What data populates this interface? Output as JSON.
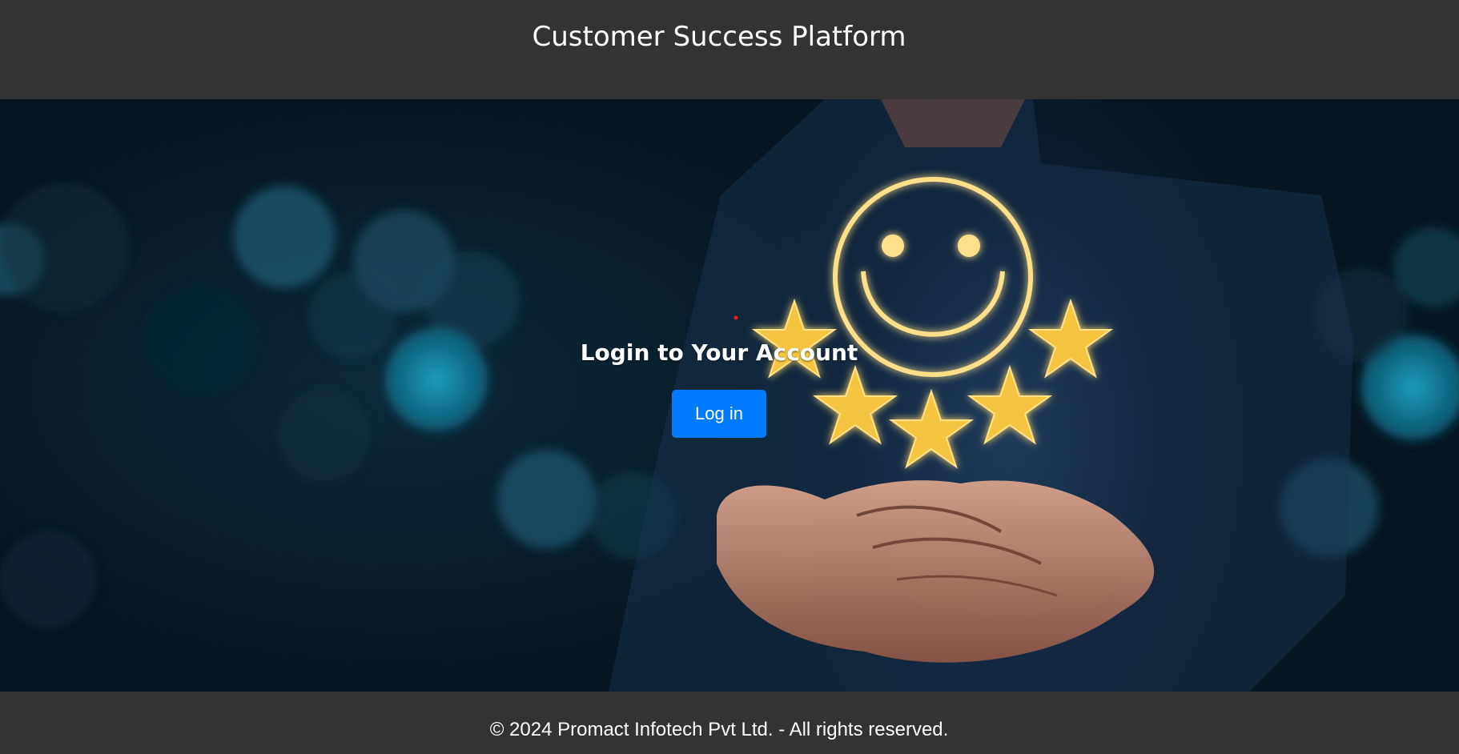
{
  "header": {
    "title": "Customer Success Platform"
  },
  "hero": {
    "image_description_icon": "smiley-face-stars-hands-icon",
    "star_count": 5
  },
  "login": {
    "heading": "Login to Your Account",
    "button_label": "Log in"
  },
  "footer": {
    "copyright": "© 2024 Promact Infotech Pvt Ltd. - All rights reserved."
  },
  "colors": {
    "bar_background": "#333333",
    "button": "#007bff",
    "glow": "#ffd966"
  }
}
